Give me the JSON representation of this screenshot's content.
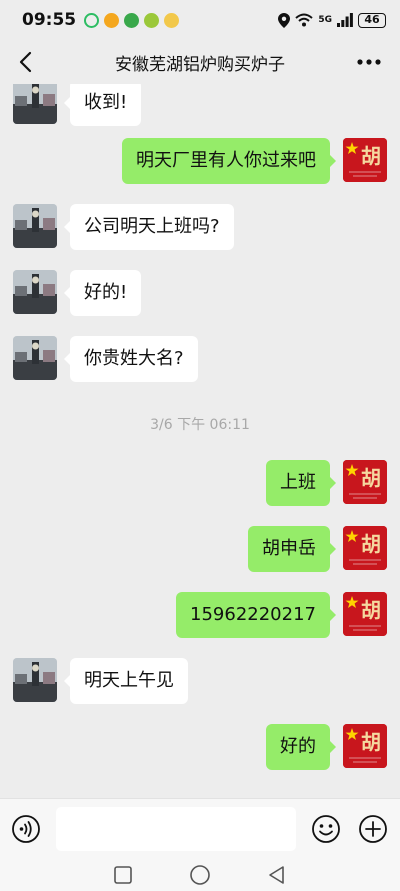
{
  "status_bar": {
    "time": "09:55",
    "network": "5G",
    "battery": "46"
  },
  "nav": {
    "title": "安徽芜湖铝炉购买炉子"
  },
  "messages": [
    {
      "side": "left",
      "text": "收到!"
    },
    {
      "side": "right",
      "text": "明天厂里有人你过来吧"
    },
    {
      "side": "left",
      "text": "公司明天上班吗?"
    },
    {
      "side": "left",
      "text": "好的!"
    },
    {
      "side": "left",
      "text": "你贵姓大名?"
    },
    {
      "side": "right",
      "text": "上班"
    },
    {
      "side": "right",
      "text": "胡申岳"
    },
    {
      "side": "right",
      "text": "15962220217"
    },
    {
      "side": "left",
      "text": "明天上午见"
    },
    {
      "side": "right",
      "text": "好的"
    }
  ],
  "timestamp": "3/6 下午 06:11",
  "avatar_right_char": "胡",
  "colors": {
    "background": "#ededed",
    "sent_bubble": "#95ec69",
    "received_bubble": "#ffffff",
    "avatar_right": "#c8161d"
  },
  "icons": {
    "back": "chevron-left-icon",
    "more": "more-dots-icon",
    "voice": "voice-icon",
    "emoji": "emoji-icon",
    "plus": "plus-icon"
  }
}
